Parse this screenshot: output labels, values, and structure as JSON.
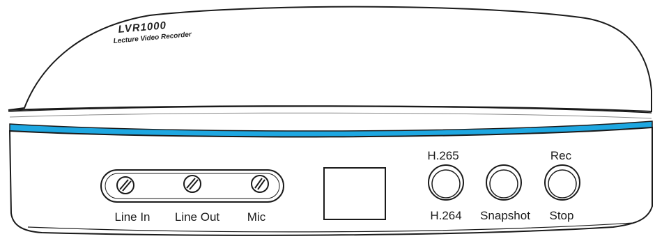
{
  "brand": {
    "model": "LVR1000",
    "tagline": "Lecture Video Recorder"
  },
  "ports": {
    "line_in": "Line In",
    "line_out": "Line Out",
    "mic": "Mic"
  },
  "buttons": {
    "codec_top": "H.265",
    "codec_bottom": "H.264",
    "snapshot": "Snapshot",
    "rec_top": "Rec",
    "rec_bottom": "Stop"
  },
  "colors": {
    "accent_stripe": "#1ea7e1",
    "outline": "#1a1a1a",
    "body": "#ffffff"
  }
}
